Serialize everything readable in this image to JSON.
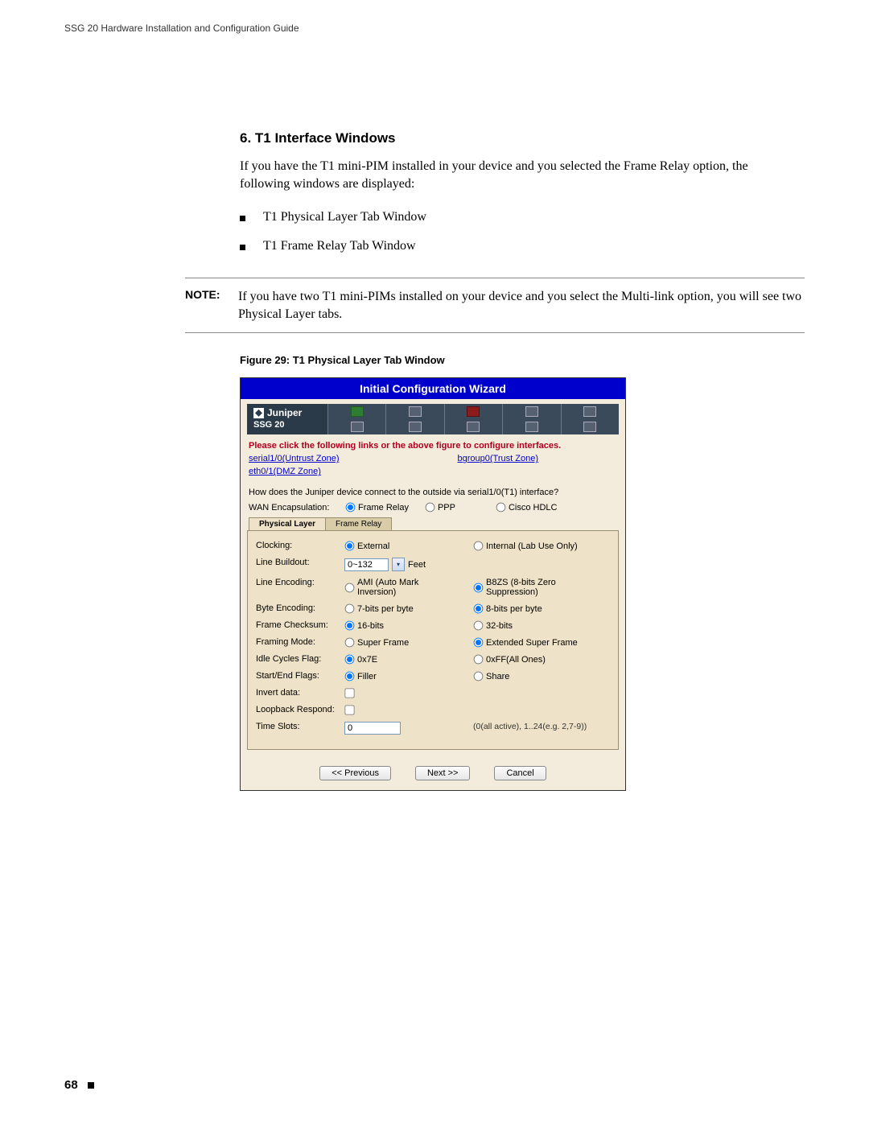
{
  "running_head": "SSG 20 Hardware Installation and Configuration Guide",
  "section_title": "6. T1 Interface Windows",
  "intro_text": "If you have the T1 mini-PIM installed in your device and you selected the Frame Relay option, the following windows are displayed:",
  "bullets": [
    "T1 Physical Layer Tab Window",
    "T1 Frame Relay Tab Window"
  ],
  "note_label": "NOTE:",
  "note_text": "If you have two T1 mini-PIMs installed on your device and you select the Multi-link option, you will see two Physical Layer tabs.",
  "figure_caption": "Figure 29:  T1 Physical Layer Tab Window",
  "wizard": {
    "title": "Initial Configuration Wizard",
    "logo_text": "Juniper",
    "device_model": "SSG 20",
    "instruction": "Please click the following links or the above figure to configure interfaces.",
    "link_serial": "serial1/0(Untrust Zone)",
    "link_bgroup": "bgroup0(Trust Zone)",
    "link_eth": "eth0/1(DMZ Zone)",
    "question": "How does the Juniper device connect to the outside via serial1/0(T1) interface?",
    "encaps_label": "WAN Encapsulation:",
    "encaps_opts": {
      "frame_relay": "Frame Relay",
      "ppp": "PPP",
      "cisco": "Cisco HDLC"
    },
    "tabs": {
      "physical": "Physical Layer",
      "frame_relay": "Frame Relay"
    },
    "fields": {
      "clocking": {
        "label": "Clocking:",
        "a": "External",
        "b": "Internal (Lab Use Only)"
      },
      "buildout": {
        "label": "Line Buildout:",
        "value": "0~132",
        "unit": "Feet"
      },
      "line_encoding": {
        "label": "Line Encoding:",
        "a": "AMI (Auto Mark Inversion)",
        "b": "B8ZS (8-bits Zero Suppression)"
      },
      "byte_encoding": {
        "label": "Byte Encoding:",
        "a": "7-bits per byte",
        "b": "8-bits per byte"
      },
      "frame_checksum": {
        "label": "Frame Checksum:",
        "a": "16-bits",
        "b": "32-bits"
      },
      "framing_mode": {
        "label": "Framing Mode:",
        "a": "Super Frame",
        "b": "Extended Super Frame"
      },
      "idle_cycles": {
        "label": "Idle Cycles Flag:",
        "a": "0x7E",
        "b": "0xFF(All Ones)"
      },
      "start_end": {
        "label": "Start/End Flags:",
        "a": "Filler",
        "b": "Share"
      },
      "invert_data": {
        "label": "Invert data:"
      },
      "loopback": {
        "label": "Loopback Respond:"
      },
      "time_slots": {
        "label": "Time Slots:",
        "value": "0",
        "hint": "(0(all active), 1..24(e.g. 2,7-9))"
      }
    },
    "buttons": {
      "prev": "<< Previous",
      "next": "Next >>",
      "cancel": "Cancel"
    }
  },
  "page_number": "68"
}
